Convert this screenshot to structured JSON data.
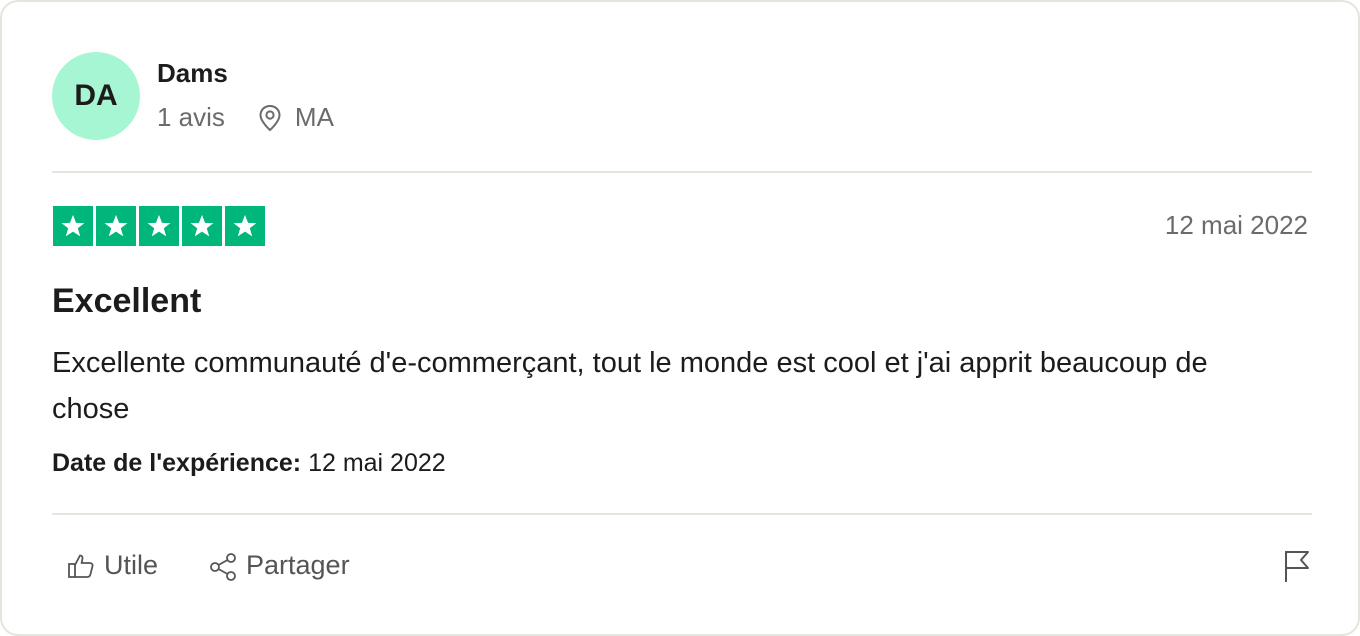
{
  "reviewer": {
    "initials": "DA",
    "name": "Dams",
    "review_count": "1 avis",
    "country": "MA",
    "avatar_color": "#a7f6d3"
  },
  "rating": {
    "stars": 5,
    "max_stars": 5,
    "star_color": "#00b67a",
    "date": "12 mai 2022"
  },
  "review": {
    "title": "Excellent",
    "body": "Excellente communauté d'e-commerçant, tout le monde est cool et j'ai apprit beaucoup de chose",
    "experience_label": "Date de l'expérience:",
    "experience_date": "12 mai 2022"
  },
  "actions": {
    "useful_label": "Utile",
    "share_label": "Partager",
    "useful_icon": "thumbs-up-icon",
    "share_icon": "share-icon",
    "flag_icon": "flag-icon"
  }
}
